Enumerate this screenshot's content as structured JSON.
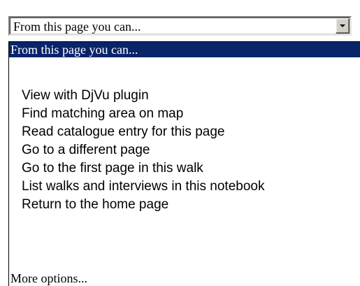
{
  "select": {
    "value": "From this page you can...",
    "arrow_icon": "dropdown-arrow-icon"
  },
  "options": {
    "header": "From this page you can...",
    "items": [
      "View with DjVu plugin",
      "Find matching area on map",
      "Read catalogue entry for this page",
      "Go to a different page",
      "Go to the first page in this walk",
      "List walks and interviews in this notebook",
      "Return to the home page"
    ],
    "more": "More options..."
  },
  "colors": {
    "selection_background": "#0a246a",
    "selection_text": "#ffffff"
  }
}
